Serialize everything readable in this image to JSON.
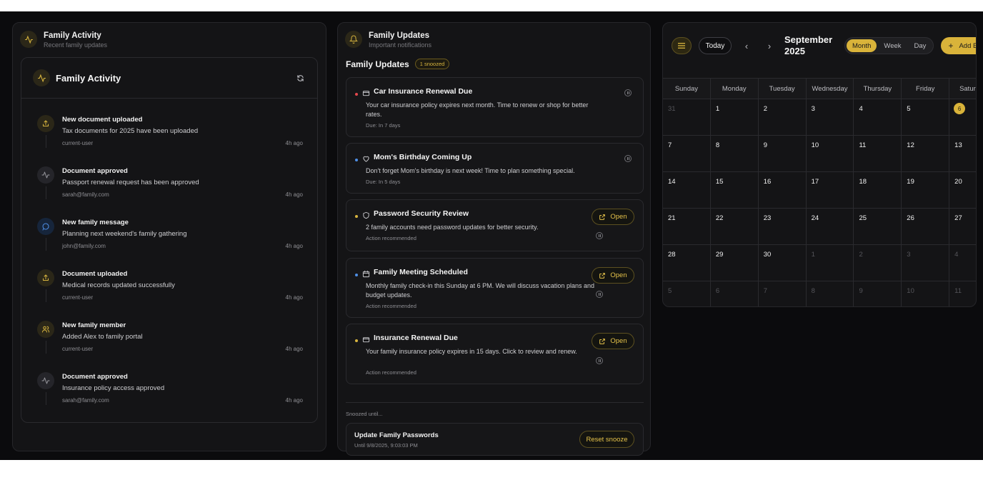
{
  "activity_panel": {
    "title": "Family Activity",
    "subtitle": "Recent family updates",
    "card_title": "Family Activity",
    "items": [
      {
        "title": "New document uploaded",
        "desc": "Tax documents for 2025 have been uploaded",
        "user": "current-user",
        "time": "4h ago",
        "icon": "upload-icon",
        "color": "#d7b43e"
      },
      {
        "title": "Document approved",
        "desc": "Passport renewal request has been approved",
        "user": "sarah@family.com",
        "time": "4h ago",
        "icon": "activity-icon",
        "color": "#9a9aa0"
      },
      {
        "title": "New family message",
        "desc": "Planning next weekend's family gathering",
        "user": "john@family.com",
        "time": "4h ago",
        "icon": "message-icon",
        "color": "#4f8fe6"
      },
      {
        "title": "Document uploaded",
        "desc": "Medical records updated successfully",
        "user": "current-user",
        "time": "4h ago",
        "icon": "upload-icon",
        "color": "#d7b43e"
      },
      {
        "title": "New family member",
        "desc": "Added Alex to family portal",
        "user": "current-user",
        "time": "4h ago",
        "icon": "users-icon",
        "color": "#d7b43e"
      },
      {
        "title": "Document approved",
        "desc": "Insurance policy access approved",
        "user": "sarah@family.com",
        "time": "4h ago",
        "icon": "activity-icon",
        "color": "#9a9aa0"
      }
    ]
  },
  "updates_panel": {
    "title": "Family Updates",
    "subtitle": "Important notifications",
    "section_title": "Family Updates",
    "snoozed_badge": "1 snoozed",
    "notifications": [
      {
        "title": "Car Insurance Renewal Due",
        "body": "Your car insurance policy expires next month. Time to renew or shop for better rates.",
        "meta": "Due: In 7 days",
        "dot": "#e5484d",
        "icon": "card-icon",
        "has_open": false
      },
      {
        "title": "Mom's Birthday Coming Up",
        "body": "Don't forget Mom's birthday is next week! Time to plan something special.",
        "meta": "Due: In 5 days",
        "dot": "#4f8fe6",
        "icon": "heart-icon",
        "has_open": false
      },
      {
        "title": "Password Security Review",
        "body": "2 family accounts need password updates for better security.",
        "meta": "Action recommended",
        "dot": "#d7b43e",
        "icon": "shield-icon",
        "has_open": true
      },
      {
        "title": "Family Meeting Scheduled",
        "body": "Monthly family check-in this Sunday at 6 PM. We will discuss vacation plans and budget updates.",
        "meta": "Action recommended",
        "dot": "#4f8fe6",
        "icon": "calendar-icon",
        "has_open": true
      },
      {
        "title": "Insurance Renewal Due",
        "body": "Your family insurance policy expires in 15 days. Click to review and renew.",
        "meta": "Action recommended",
        "dot": "#d7b43e",
        "icon": "card-icon",
        "has_open": true
      }
    ],
    "open_label": "Open",
    "snoozed_label": "Snoozed until...",
    "snoozed_item": {
      "title": "Update Family Passwords",
      "until": "Until 9/8/2025, 9:03:03 PM",
      "reset_label": "Reset snooze"
    }
  },
  "calendar": {
    "today_label": "Today",
    "month_title": "September 2025",
    "views": [
      "Month",
      "Week",
      "Day"
    ],
    "active_view": "Month",
    "add_label": "Add Event",
    "weekdays": [
      "Sunday",
      "Monday",
      "Tuesday",
      "Wednesday",
      "Thursday",
      "Friday",
      "Saturday"
    ],
    "weeks": [
      [
        {
          "d": "31",
          "m": true
        },
        {
          "d": "1"
        },
        {
          "d": "2"
        },
        {
          "d": "3"
        },
        {
          "d": "4"
        },
        {
          "d": "5"
        },
        {
          "d": "6",
          "t": true
        }
      ],
      [
        {
          "d": "7"
        },
        {
          "d": "8"
        },
        {
          "d": "9"
        },
        {
          "d": "10"
        },
        {
          "d": "11"
        },
        {
          "d": "12"
        },
        {
          "d": "13"
        }
      ],
      [
        {
          "d": "14"
        },
        {
          "d": "15"
        },
        {
          "d": "16"
        },
        {
          "d": "17"
        },
        {
          "d": "18"
        },
        {
          "d": "19"
        },
        {
          "d": "20"
        }
      ],
      [
        {
          "d": "21"
        },
        {
          "d": "22"
        },
        {
          "d": "23"
        },
        {
          "d": "24"
        },
        {
          "d": "25"
        },
        {
          "d": "26"
        },
        {
          "d": "27"
        }
      ],
      [
        {
          "d": "28"
        },
        {
          "d": "29"
        },
        {
          "d": "30"
        },
        {
          "d": "1",
          "m": true
        },
        {
          "d": "2",
          "m": true
        },
        {
          "d": "3",
          "m": true
        },
        {
          "d": "4",
          "m": true
        }
      ],
      [
        {
          "d": "5",
          "m": true
        },
        {
          "d": "6",
          "m": true
        },
        {
          "d": "7",
          "m": true
        },
        {
          "d": "8",
          "m": true
        },
        {
          "d": "9",
          "m": true
        },
        {
          "d": "10",
          "m": true
        },
        {
          "d": "11",
          "m": true
        }
      ]
    ]
  }
}
